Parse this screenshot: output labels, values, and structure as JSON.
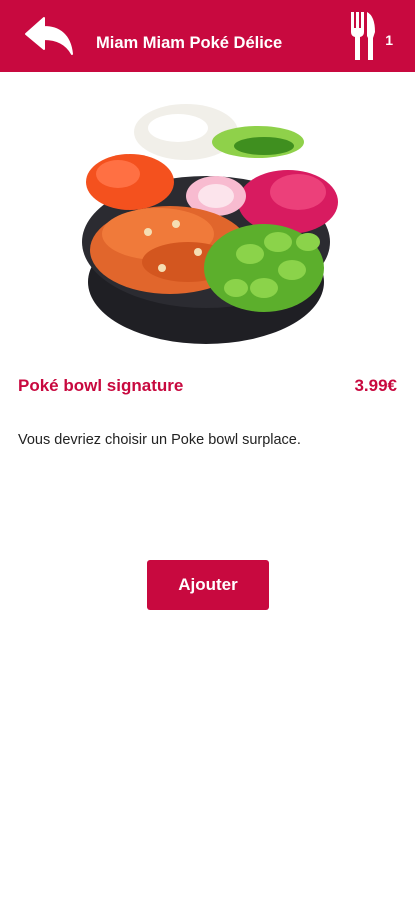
{
  "header": {
    "title": "Miam Miam Poké Délice",
    "back_icon": "back-arrow-icon",
    "cart_icon": "fork-knife-icon",
    "cart_count": "1"
  },
  "product": {
    "image_icon": "poke-bowl-image",
    "name": "Poké bowl signature",
    "price": "3.99€",
    "description": "Vous devriez choisir un Poke bowl surplace."
  },
  "actions": {
    "add_label": "Ajouter"
  },
  "colors": {
    "brand": "#c8093f",
    "text": "#222222",
    "background": "#ffffff"
  }
}
